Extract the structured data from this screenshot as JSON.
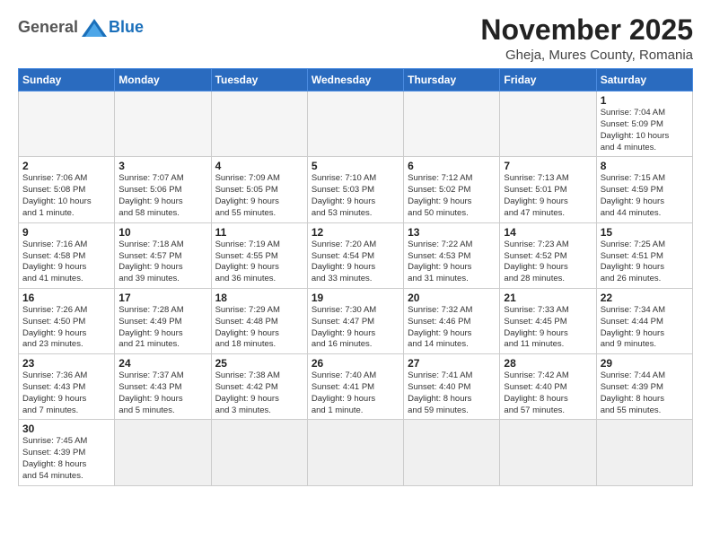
{
  "header": {
    "logo_general": "General",
    "logo_blue": "Blue",
    "month_title": "November 2025",
    "subtitle": "Gheja, Mures County, Romania"
  },
  "weekdays": [
    "Sunday",
    "Monday",
    "Tuesday",
    "Wednesday",
    "Thursday",
    "Friday",
    "Saturday"
  ],
  "days": [
    {
      "date": "",
      "info": ""
    },
    {
      "date": "",
      "info": ""
    },
    {
      "date": "",
      "info": ""
    },
    {
      "date": "",
      "info": ""
    },
    {
      "date": "",
      "info": ""
    },
    {
      "date": "",
      "info": ""
    },
    {
      "date": "1",
      "info": "Sunrise: 7:04 AM\nSunset: 5:09 PM\nDaylight: 10 hours\nand 4 minutes."
    },
    {
      "date": "2",
      "info": "Sunrise: 7:06 AM\nSunset: 5:08 PM\nDaylight: 10 hours\nand 1 minute."
    },
    {
      "date": "3",
      "info": "Sunrise: 7:07 AM\nSunset: 5:06 PM\nDaylight: 9 hours\nand 58 minutes."
    },
    {
      "date": "4",
      "info": "Sunrise: 7:09 AM\nSunset: 5:05 PM\nDaylight: 9 hours\nand 55 minutes."
    },
    {
      "date": "5",
      "info": "Sunrise: 7:10 AM\nSunset: 5:03 PM\nDaylight: 9 hours\nand 53 minutes."
    },
    {
      "date": "6",
      "info": "Sunrise: 7:12 AM\nSunset: 5:02 PM\nDaylight: 9 hours\nand 50 minutes."
    },
    {
      "date": "7",
      "info": "Sunrise: 7:13 AM\nSunset: 5:01 PM\nDaylight: 9 hours\nand 47 minutes."
    },
    {
      "date": "8",
      "info": "Sunrise: 7:15 AM\nSunset: 4:59 PM\nDaylight: 9 hours\nand 44 minutes."
    },
    {
      "date": "9",
      "info": "Sunrise: 7:16 AM\nSunset: 4:58 PM\nDaylight: 9 hours\nand 41 minutes."
    },
    {
      "date": "10",
      "info": "Sunrise: 7:18 AM\nSunset: 4:57 PM\nDaylight: 9 hours\nand 39 minutes."
    },
    {
      "date": "11",
      "info": "Sunrise: 7:19 AM\nSunset: 4:55 PM\nDaylight: 9 hours\nand 36 minutes."
    },
    {
      "date": "12",
      "info": "Sunrise: 7:20 AM\nSunset: 4:54 PM\nDaylight: 9 hours\nand 33 minutes."
    },
    {
      "date": "13",
      "info": "Sunrise: 7:22 AM\nSunset: 4:53 PM\nDaylight: 9 hours\nand 31 minutes."
    },
    {
      "date": "14",
      "info": "Sunrise: 7:23 AM\nSunset: 4:52 PM\nDaylight: 9 hours\nand 28 minutes."
    },
    {
      "date": "15",
      "info": "Sunrise: 7:25 AM\nSunset: 4:51 PM\nDaylight: 9 hours\nand 26 minutes."
    },
    {
      "date": "16",
      "info": "Sunrise: 7:26 AM\nSunset: 4:50 PM\nDaylight: 9 hours\nand 23 minutes."
    },
    {
      "date": "17",
      "info": "Sunrise: 7:28 AM\nSunset: 4:49 PM\nDaylight: 9 hours\nand 21 minutes."
    },
    {
      "date": "18",
      "info": "Sunrise: 7:29 AM\nSunset: 4:48 PM\nDaylight: 9 hours\nand 18 minutes."
    },
    {
      "date": "19",
      "info": "Sunrise: 7:30 AM\nSunset: 4:47 PM\nDaylight: 9 hours\nand 16 minutes."
    },
    {
      "date": "20",
      "info": "Sunrise: 7:32 AM\nSunset: 4:46 PM\nDaylight: 9 hours\nand 14 minutes."
    },
    {
      "date": "21",
      "info": "Sunrise: 7:33 AM\nSunset: 4:45 PM\nDaylight: 9 hours\nand 11 minutes."
    },
    {
      "date": "22",
      "info": "Sunrise: 7:34 AM\nSunset: 4:44 PM\nDaylight: 9 hours\nand 9 minutes."
    },
    {
      "date": "23",
      "info": "Sunrise: 7:36 AM\nSunset: 4:43 PM\nDaylight: 9 hours\nand 7 minutes."
    },
    {
      "date": "24",
      "info": "Sunrise: 7:37 AM\nSunset: 4:43 PM\nDaylight: 9 hours\nand 5 minutes."
    },
    {
      "date": "25",
      "info": "Sunrise: 7:38 AM\nSunset: 4:42 PM\nDaylight: 9 hours\nand 3 minutes."
    },
    {
      "date": "26",
      "info": "Sunrise: 7:40 AM\nSunset: 4:41 PM\nDaylight: 9 hours\nand 1 minute."
    },
    {
      "date": "27",
      "info": "Sunrise: 7:41 AM\nSunset: 4:40 PM\nDaylight: 8 hours\nand 59 minutes."
    },
    {
      "date": "28",
      "info": "Sunrise: 7:42 AM\nSunset: 4:40 PM\nDaylight: 8 hours\nand 57 minutes."
    },
    {
      "date": "29",
      "info": "Sunrise: 7:44 AM\nSunset: 4:39 PM\nDaylight: 8 hours\nand 55 minutes."
    },
    {
      "date": "30",
      "info": "Sunrise: 7:45 AM\nSunset: 4:39 PM\nDaylight: 8 hours\nand 54 minutes."
    },
    {
      "date": "",
      "info": ""
    }
  ]
}
